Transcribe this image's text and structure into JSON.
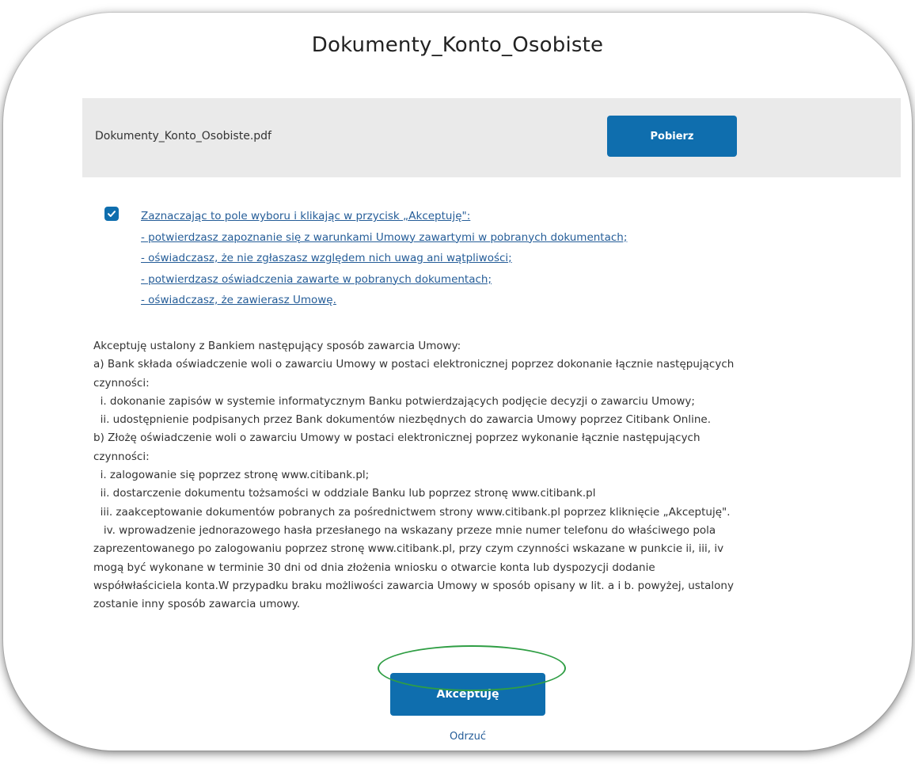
{
  "dialog": {
    "title": "Dokumenty_Konto_Osobiste"
  },
  "file": {
    "name": "Dokumenty_Konto_Osobiste.pdf",
    "download_label": "Pobierz"
  },
  "consent": {
    "checked": true,
    "lines": [
      "Zaznaczając to pole wyboru i klikając w przycisk „Akceptuję\":",
      "- potwierdzasz zapoznanie się z warunkami Umowy zawartymi w pobranych dokumentach;",
      "- oświadczasz, że nie zgłaszasz względem nich uwag ani wątpliwości;",
      "- potwierdzasz oświadczenia zawarte w pobranych dokumentach;",
      "- oświadczasz, że zawierasz Umowę."
    ]
  },
  "terms": {
    "lines": [
      "Akceptuję ustalony z Bankiem następujący sposób zawarcia Umowy:",
      "a) Bank składa oświadczenie woli o zawarciu Umowy w postaci elektronicznej poprzez dokonanie łącznie następujących",
      "czynności:",
      "  i. dokonanie zapisów w systemie informatycznym Banku potwierdzających podjęcie decyzji o zawarciu Umowy;",
      "  ii. udostępnienie podpisanych przez Bank dokumentów niezbędnych do zawarcia Umowy poprzez Citibank Online.",
      "b) Złożę oświadczenie woli o zawarciu Umowy w postaci elektronicznej poprzez wykonanie łącznie następujących",
      "czynności:",
      "  i. zalogowanie się poprzez stronę www.citibank.pl;",
      "  ii. dostarczenie dokumentu tożsamości w oddziale Banku lub poprzez stronę www.citibank.pl",
      "  iii. zaakceptowanie dokumentów pobranych za pośrednictwem strony www.citibank.pl poprzez kliknięcie „Akceptuję\".",
      "   iv. wprowadzenie jednorazowego hasła przesłanego na wskazany przeze mnie numer telefonu do właściwego pola",
      "zaprezentowanego po zalogowaniu poprzez stronę www.citibank.pl, przy czym czynności wskazane w punkcie ii, iii, iv",
      "mogą być wykonane w terminie 30 dni od dnia złożenia wniosku o otwarcie konta lub dyspozycji dodanie",
      "współwłaściciela konta.W przypadku braku możliwości zawarcia Umowy w sposób opisany w lit. a i b. powyżej, ustalony",
      "zostanie inny sposób zawarcia umowy."
    ]
  },
  "actions": {
    "accept_label": "Akceptuję",
    "reject_label": "Odrzuć"
  },
  "colors": {
    "primary_button": "#0f6eae",
    "link": "#255d98",
    "file_bar_bg": "#eaeaea",
    "annotation": "#2f9e44"
  }
}
